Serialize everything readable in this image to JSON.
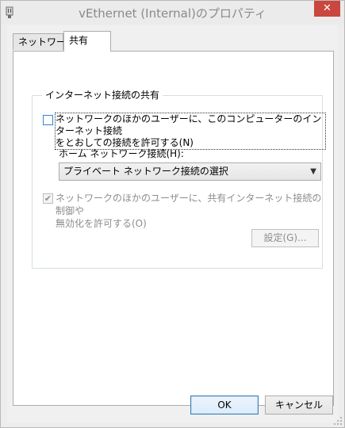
{
  "window": {
    "title": "vEthernet (Internal)のプロパティ",
    "close_glyph": "✕"
  },
  "tabs": [
    {
      "label": "ネットワーク"
    },
    {
      "label": "共有"
    }
  ],
  "sharing": {
    "group_title": "インターネット接続の共有",
    "allow_connect": {
      "checked": false,
      "label_line1": "ネットワークのほかのユーザーに、このコンピューターのインターネット接続",
      "label_line2": "をとおしての接続を許可する(N)"
    },
    "home_network_label": "ホーム ネットワーク接続(H):",
    "home_network_select": "プライベート ネットワーク接続の選択",
    "allow_control": {
      "checked": true,
      "check_glyph": "✔",
      "label_line1": "ネットワークのほかのユーザーに、共有インターネット接続の制御や",
      "label_line2": "無効化を許可する(O)"
    },
    "settings_button": "設定(G)..."
  },
  "footer": {
    "ok": "OK",
    "cancel": "キャンセル"
  },
  "colors": {
    "accent": "#2f84d6",
    "close": "#c9473e"
  }
}
